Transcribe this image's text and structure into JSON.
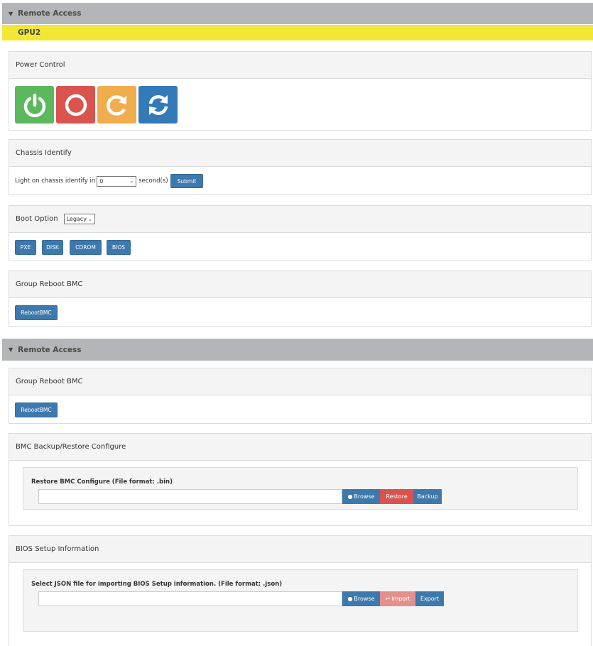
{
  "remote_access_1": {
    "title": "Remote Access"
  },
  "gpu_label": "GPU2",
  "power_control": {
    "title": "Power Control",
    "buttons": [
      {
        "name": "power-on",
        "color": "#5cb85c",
        "icon": "power-icon"
      },
      {
        "name": "power-off",
        "color": "#d9534f",
        "icon": "circle-icon"
      },
      {
        "name": "power-reset",
        "color": "#f0ad4e",
        "icon": "reset-icon"
      },
      {
        "name": "power-cycle",
        "color": "#337ab7",
        "icon": "cycle-icon"
      }
    ]
  },
  "chassis_identify": {
    "title": "Chassis Identify",
    "prefix": "Light on chassis identify in",
    "value": "0",
    "suffix": "second(s)",
    "submit_label": "Submit"
  },
  "boot_option": {
    "title": "Boot Option",
    "select_value": "Legacy",
    "buttons": [
      "PXE",
      "DISK",
      "CDROM",
      "BIOS"
    ]
  },
  "group_reboot_1": {
    "title": "Group Reboot BMC",
    "button_label": "RebootBMC"
  },
  "remote_access_2": {
    "title": "Remote Access"
  },
  "group_reboot_2": {
    "title": "Group Reboot BMC",
    "button_label": "RebootBMC"
  },
  "bmc_backup": {
    "title": "BMC Backup/Restore Configure",
    "inner_label": "Restore BMC Configure (File format: .bin)",
    "file_value": "",
    "browse_label": "Browse",
    "restore_label": "Restore",
    "backup_label": "Backup"
  },
  "bios_setup": {
    "title": "BIOS Setup Information",
    "inner_label": "Select JSON file for importing BIOS Setup information. (File format: .json)",
    "file_value": "",
    "browse_label": "Browse",
    "import_label": "Import",
    "export_label": "Export"
  },
  "colors": {
    "header_gray": "#b3b5b8",
    "gpu_yellow": "#f2e733",
    "button_blue": "#3d79ad",
    "restore_red": "#d9534f",
    "import_red_disabled": "#e3908d"
  }
}
